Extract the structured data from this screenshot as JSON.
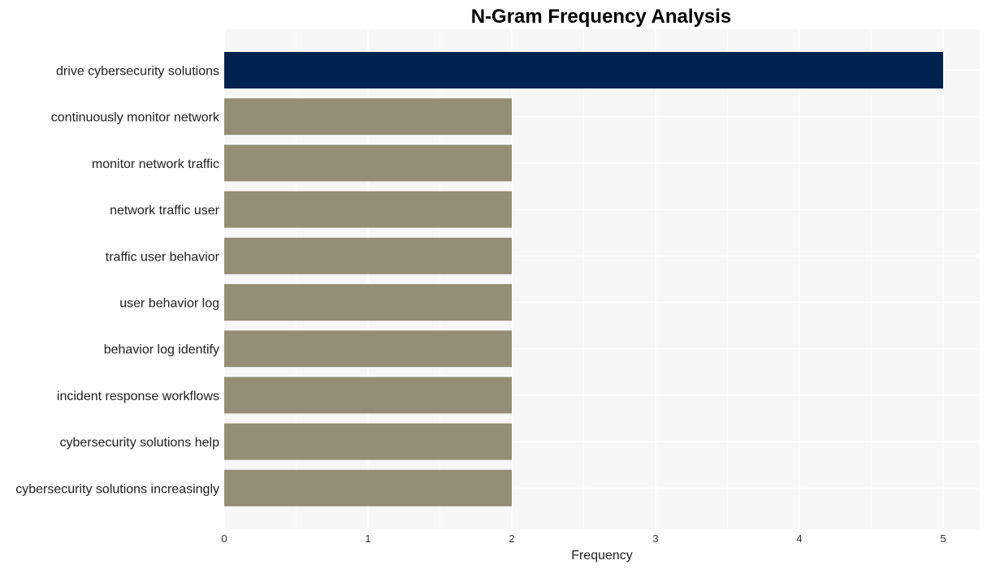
{
  "chart_data": {
    "type": "bar",
    "orientation": "horizontal",
    "title": "N-Gram Frequency Analysis",
    "xlabel": "Frequency",
    "ylabel": "",
    "xlim": [
      0,
      5.25
    ],
    "xticks": [
      0,
      1,
      2,
      3,
      4,
      5
    ],
    "grid": true,
    "legend": null,
    "categories": [
      "drive cybersecurity solutions",
      "continuously monitor network",
      "monitor network traffic",
      "network traffic user",
      "traffic user behavior",
      "user behavior log",
      "behavior log identify",
      "incident response workflows",
      "cybersecurity solutions help",
      "cybersecurity solutions increasingly"
    ],
    "values": [
      5,
      2,
      2,
      2,
      2,
      2,
      2,
      2,
      2,
      2
    ],
    "colors": {
      "highlight": "#00224e",
      "default": "#958e76",
      "panel_background": "#f7f7f7",
      "grid": "#ffffff"
    }
  }
}
